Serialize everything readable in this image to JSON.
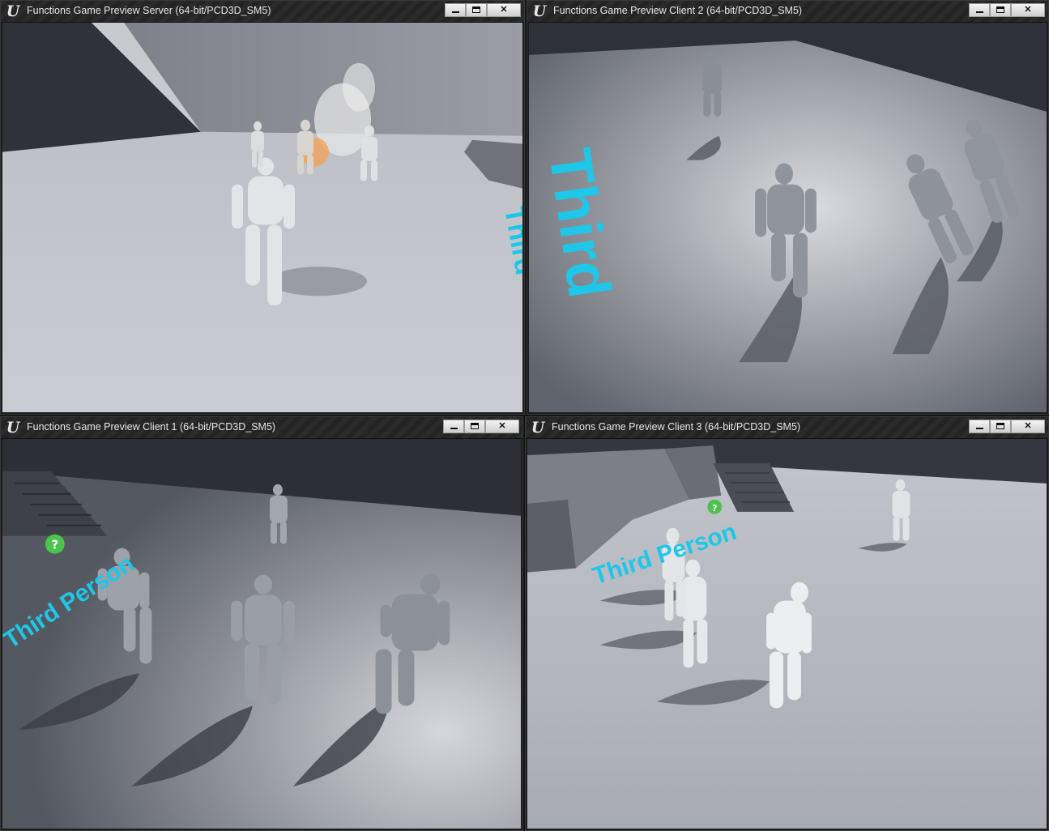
{
  "windows": [
    {
      "id": "server",
      "title": "Functions Game Preview Server (64-bit/PCD3D_SM5)",
      "minimize": "minimize",
      "maximize": "maximize",
      "close": "✕"
    },
    {
      "id": "client2",
      "title": "Functions Game Preview Client 2 (64-bit/PCD3D_SM5)",
      "minimize": "minimize",
      "maximize": "maximize",
      "close": "✕"
    },
    {
      "id": "client1",
      "title": "Functions Game Preview Client 1 (64-bit/PCD3D_SM5)",
      "minimize": "minimize",
      "maximize": "maximize",
      "close": "✕"
    },
    {
      "id": "client3",
      "title": "Functions Game Preview Client 3 (64-bit/PCD3D_SM5)",
      "minimize": "minimize",
      "maximize": "maximize",
      "close": "✕"
    }
  ],
  "floor_text": {
    "server": "Third",
    "client2": "Third",
    "client1": "Third Person",
    "client3": "Third Person"
  },
  "colors": {
    "floor_text": "#1fc6e8",
    "titlebar": "#2a2a2a",
    "floor": "#c9ccd2",
    "wall": "#3a3d44"
  },
  "icons": {
    "app": "unreal-engine-logo-icon",
    "minimize": "minimize-icon",
    "maximize": "maximize-icon",
    "close": "close-icon",
    "pickup": "question-mark-icon"
  }
}
